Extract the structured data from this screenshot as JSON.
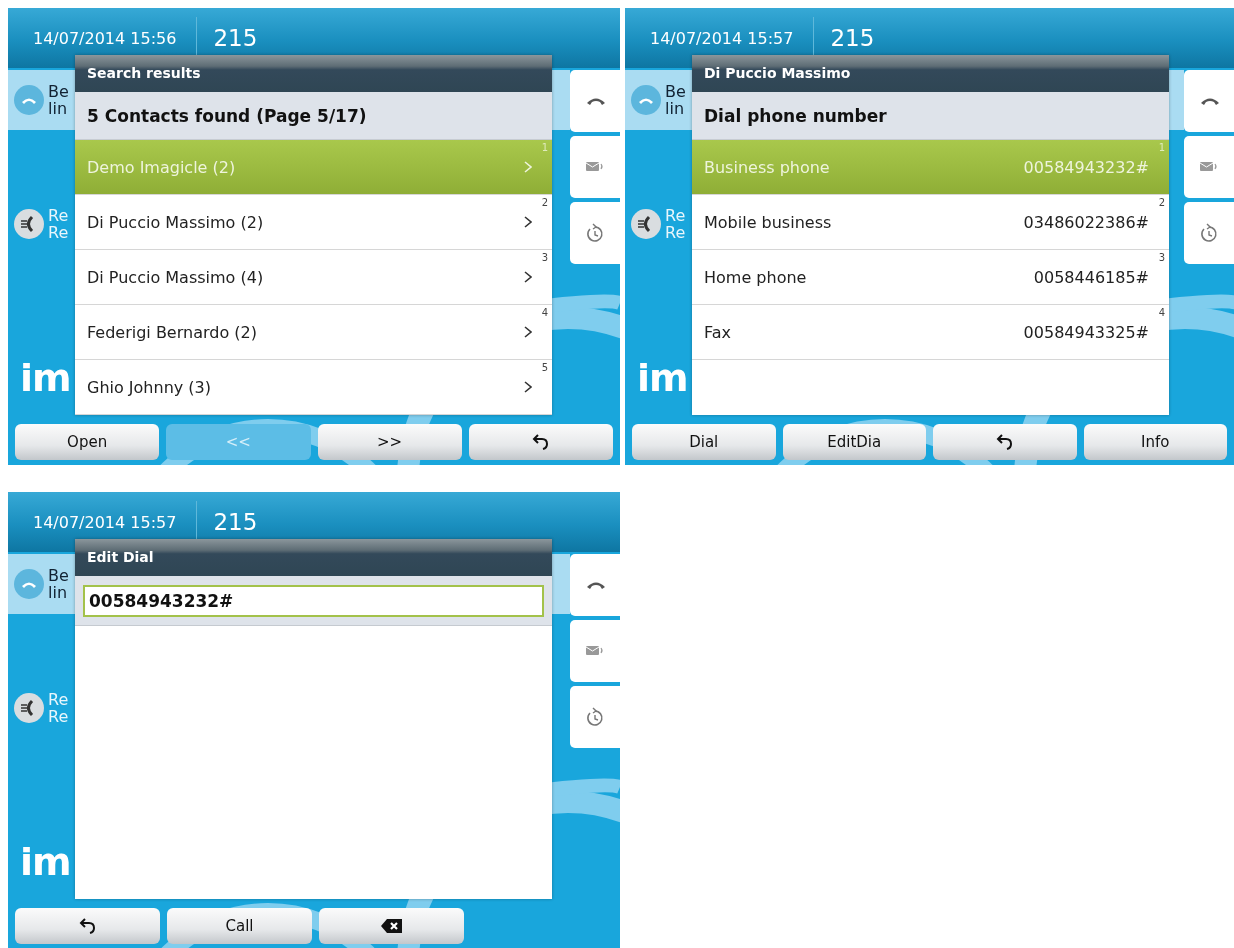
{
  "screens": [
    {
      "datetime": "14/07/2014 15:56",
      "extension": "215",
      "background_items": [
        {
          "kind": "line",
          "texts": [
            "Be",
            "lin"
          ]
        },
        {
          "kind": "recent",
          "texts": [
            "Re",
            "Re"
          ]
        }
      ],
      "logo": "im",
      "dialog": {
        "kind": "list",
        "title": "Search results",
        "subtitle": "5 Contacts found (Page 5/17)",
        "rows": [
          {
            "label": "Demo Imagicle (2)",
            "index": "1",
            "selected": true
          },
          {
            "label": "Di Puccio Massimo (2)",
            "index": "2",
            "selected": false
          },
          {
            "label": "Di Puccio Massimo (4)",
            "index": "3",
            "selected": false
          },
          {
            "label": "Federigi Bernardo (2)",
            "index": "4",
            "selected": false
          },
          {
            "label": "Ghio Johnny (3)",
            "index": "5",
            "selected": false
          }
        ]
      },
      "softkeys": [
        {
          "kind": "text",
          "label": "Open",
          "disabled": false
        },
        {
          "kind": "text",
          "label": "<<",
          "disabled": true
        },
        {
          "kind": "text",
          "label": ">>",
          "disabled": false
        },
        {
          "kind": "back",
          "disabled": false
        }
      ]
    },
    {
      "datetime": "14/07/2014 15:57",
      "extension": "215",
      "background_items": [
        {
          "kind": "line",
          "texts": [
            "Be",
            "lin"
          ]
        },
        {
          "kind": "recent",
          "texts": [
            "Re",
            "Re"
          ]
        }
      ],
      "logo": "im",
      "dialog": {
        "kind": "list",
        "title": "Di Puccio Massimo",
        "subtitle": "Dial phone number",
        "rows": [
          {
            "label": "Business phone",
            "value": "00584943232#",
            "index": "1",
            "selected": true
          },
          {
            "label": "Mobile business",
            "value": "03486022386#",
            "index": "2",
            "selected": false
          },
          {
            "label": "Home phone",
            "value": "0058446185#",
            "index": "3",
            "selected": false
          },
          {
            "label": "Fax",
            "value": "00584943325#",
            "index": "4",
            "selected": false
          }
        ]
      },
      "softkeys": [
        {
          "kind": "text",
          "label": "Dial",
          "disabled": false
        },
        {
          "kind": "text",
          "label": "EditDia",
          "disabled": false
        },
        {
          "kind": "back",
          "disabled": false
        },
        {
          "kind": "text",
          "label": "Info",
          "disabled": false
        }
      ]
    },
    {
      "datetime": "14/07/2014 15:57",
      "extension": "215",
      "background_items": [
        {
          "kind": "line",
          "texts": [
            "Be",
            "lin"
          ]
        },
        {
          "kind": "recent",
          "texts": [
            "Re",
            "Re"
          ]
        }
      ],
      "logo": "im",
      "dialog": {
        "kind": "edit",
        "title": "Edit Dial",
        "field_value": "00584943232#"
      },
      "softkeys": [
        {
          "kind": "back",
          "disabled": false
        },
        {
          "kind": "text",
          "label": "Call",
          "disabled": false
        },
        {
          "kind": "backspace",
          "disabled": false
        }
      ]
    }
  ]
}
